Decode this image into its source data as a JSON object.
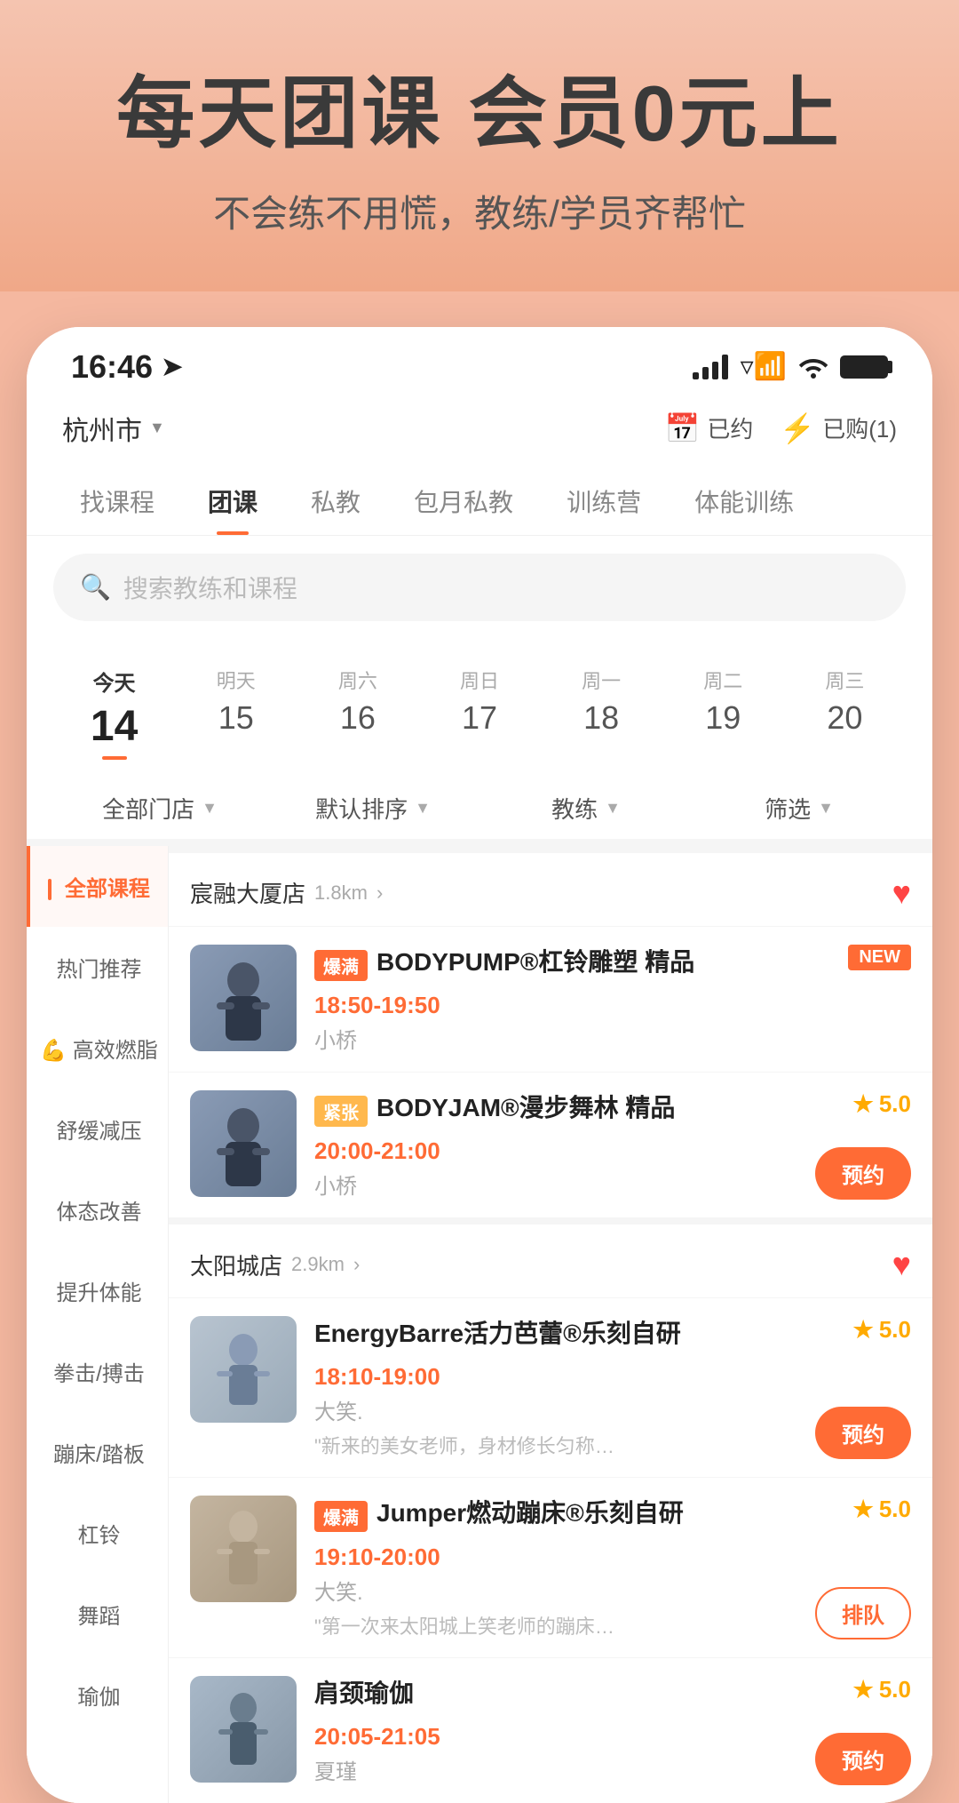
{
  "hero": {
    "title": "每天团课 会员0元上",
    "subtitle": "不会练不用慌，教练/学员齐帮忙"
  },
  "statusBar": {
    "time": "16:46",
    "location_icon": "➤"
  },
  "topNav": {
    "city": "杭州市",
    "booked_label": "已约",
    "purchased_label": "已购(1)"
  },
  "tabs": [
    {
      "id": "find",
      "label": "找课程",
      "active": false
    },
    {
      "id": "group",
      "label": "团课",
      "active": true
    },
    {
      "id": "private",
      "label": "私教",
      "active": false
    },
    {
      "id": "monthly",
      "label": "包月私教",
      "active": false
    },
    {
      "id": "camp",
      "label": "训练营",
      "active": false
    },
    {
      "id": "fitness",
      "label": "体能训练",
      "active": false
    }
  ],
  "search": {
    "placeholder": "搜索教练和课程"
  },
  "dates": [
    {
      "label": "今天",
      "num": "14",
      "active": true
    },
    {
      "label": "明天",
      "num": "15",
      "active": false
    },
    {
      "label": "周六",
      "num": "16",
      "active": false
    },
    {
      "label": "周日",
      "num": "17",
      "active": false
    },
    {
      "label": "周一",
      "num": "18",
      "active": false
    },
    {
      "label": "周二",
      "num": "19",
      "active": false
    },
    {
      "label": "周三",
      "num": "20",
      "active": false
    }
  ],
  "filters": [
    {
      "label": "全部门店"
    },
    {
      "label": "默认排序"
    },
    {
      "label": "教练"
    },
    {
      "label": "筛选"
    }
  ],
  "sidebar": {
    "items": [
      {
        "label": "全部课程",
        "active": true
      },
      {
        "label": "热门推荐",
        "active": false
      },
      {
        "label": "💪 高效燃脂",
        "active": false
      },
      {
        "label": "舒缓减压",
        "active": false
      },
      {
        "label": "体态改善",
        "active": false
      },
      {
        "label": "提升体能",
        "active": false
      },
      {
        "label": "拳击/搏击",
        "active": false
      },
      {
        "label": "蹦床/踏板",
        "active": false
      },
      {
        "label": "杠铃",
        "active": false
      },
      {
        "label": "舞蹈",
        "active": false
      },
      {
        "label": "瑜伽",
        "active": false
      }
    ]
  },
  "stores": [
    {
      "name": "宸融大厦店",
      "distance": "1.8km",
      "favorited": true,
      "courses": [
        {
          "tag": "爆满",
          "tagType": "hot",
          "badge": "NEW",
          "name": "BODYPUMP®杠铃雕塑 精品",
          "time": "18:50-19:50",
          "teacher": "小桥",
          "rating": null,
          "hasBookBtn": false,
          "thumbType": "dark"
        },
        {
          "tag": "紧张",
          "tagType": "tight",
          "badge": null,
          "name": "BODYJAM®漫步舞林 精品",
          "time": "20:00-21:00",
          "teacher": "小桥",
          "rating": "5.0",
          "hasBookBtn": true,
          "btnLabel": "预约",
          "thumbType": "dark"
        }
      ]
    },
    {
      "name": "太阳城店",
      "distance": "2.9km",
      "favorited": true,
      "courses": [
        {
          "tag": null,
          "tagType": null,
          "badge": null,
          "name": "EnergyBarre活力芭蕾®乐刻自研",
          "time": "18:10-19:00",
          "teacher": "大笑.",
          "rating": "5.0",
          "hasBookBtn": true,
          "btnLabel": "预约",
          "desc": "\"新来的美女老师，身材修长匀称，教...",
          "thumbType": "light"
        },
        {
          "tag": "爆满",
          "tagType": "hot",
          "badge": null,
          "name": "Jumper燃动蹦床®乐刻自研",
          "time": "19:10-20:00",
          "teacher": "大笑.",
          "rating": "5.0",
          "hasBookBtn": false,
          "queueBtn": true,
          "btnLabel": "排队",
          "desc": "\"第一次来太阳城上笑老师的蹦床课...",
          "thumbType": "blonde"
        },
        {
          "tag": null,
          "tagType": null,
          "badge": null,
          "name": "肩颈瑜伽",
          "time": "20:05-21:05",
          "teacher": "夏瑾",
          "rating": "5.0",
          "hasBookBtn": true,
          "btnLabel": "预约",
          "thumbType": "medium"
        }
      ]
    }
  ]
}
